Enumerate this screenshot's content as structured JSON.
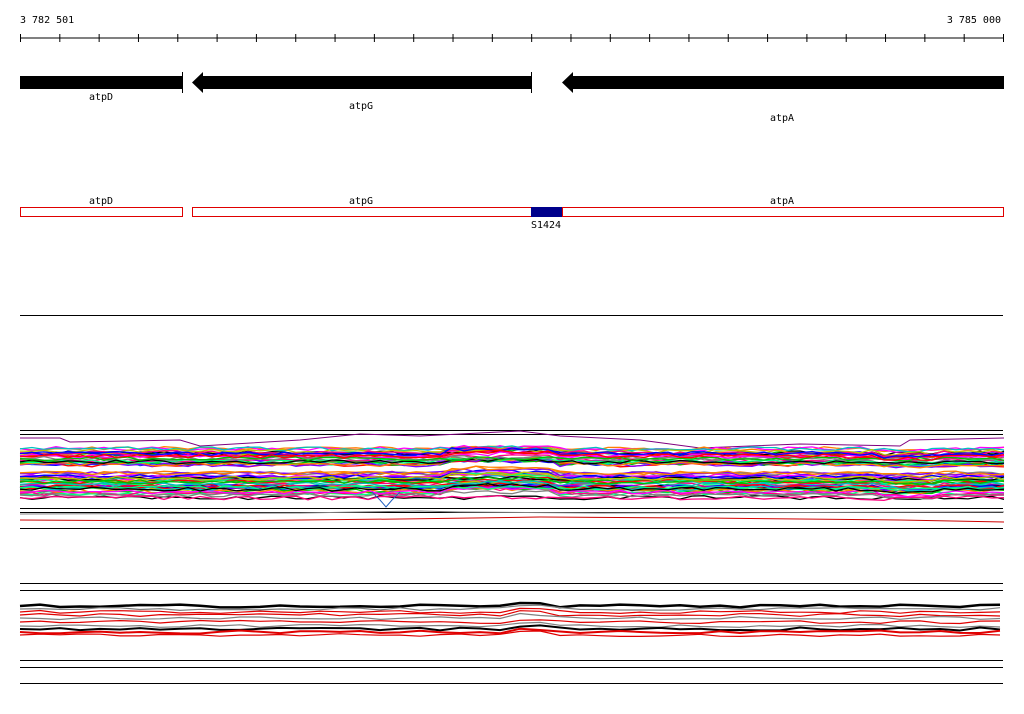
{
  "ruler": {
    "start_label": "3 782 501",
    "end_label": "3 785 000",
    "start": 3782501,
    "end": 3785000,
    "tick_count": 26
  },
  "genes": [
    {
      "name": "atpD",
      "strand": "-"
    },
    {
      "name": "atpG",
      "strand": "-"
    },
    {
      "name": "atpA",
      "strand": "-"
    }
  ],
  "feature_track": {
    "border_color": "#e00000",
    "items": [
      {
        "name": "atpD"
      },
      {
        "name": "atpG"
      },
      {
        "name": "atpA"
      }
    ],
    "marker": {
      "label": "S1424",
      "color": "#00008b"
    }
  },
  "colors": {
    "gene_arrow": "#000000",
    "line_palette": [
      "#ff00ff",
      "#00c000",
      "#0000ff",
      "#ff0000",
      "#00c0c0",
      "#c0c000",
      "#8000ff",
      "#ff8000",
      "#00ff80",
      "#000000",
      "#808080",
      "#ff0080"
    ],
    "lower_palette": [
      "#000000",
      "#e00000",
      "#808080"
    ]
  }
}
